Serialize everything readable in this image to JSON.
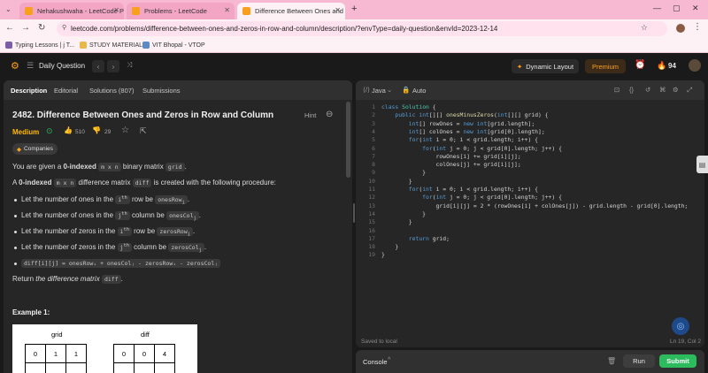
{
  "browser": {
    "tabs": [
      {
        "title": "Nehakushwaha - LeetCode Pro"
      },
      {
        "title": "Problems - LeetCode"
      },
      {
        "title": "Difference Between Ones and"
      }
    ],
    "url": "leetcode.com/problems/difference-between-ones-and-zeros-in-row-and-column/description/?envType=daily-question&envId=2023-12-14",
    "bookmarks": [
      "Typing Lessons | j T...",
      "STUDY MATERIAL",
      "VIT Bhopal - VTOP"
    ]
  },
  "header": {
    "title": "Daily Question",
    "dynamic_layout": "Dynamic Layout",
    "premium": "Premium",
    "streak": "94"
  },
  "left_tabs": [
    "Description",
    "Editorial",
    "Solutions (807)",
    "Submissions"
  ],
  "problem": {
    "title": "2482. Difference Between Ones and Zeros in Row and Column",
    "hint": "Hint",
    "difficulty": "Medium",
    "likes": "510",
    "dislikes": "29",
    "companies": "Companies",
    "intro_pre": "You are given a ",
    "intro_bold": "0-indexed",
    "intro_mid": "m x n",
    "intro_post": " binary matrix ",
    "intro_code": "grid",
    "intro_end": ".",
    "diff_pre": "A ",
    "diff_bold": "0-indexed",
    "diff_mid": "m x n",
    "diff_post": " difference matrix ",
    "diff_code": "diff",
    "diff_end": " is created with the following procedure:",
    "bullets": [
      {
        "pre": "Let the number of ones in the ",
        "sup": "i",
        "supx": "th",
        "mid": " row be ",
        "code": "onesRow",
        "sub": "i",
        "end": "."
      },
      {
        "pre": "Let the number of ones in the ",
        "sup": "j",
        "supx": "th",
        "mid": " column be ",
        "code": "onesCol",
        "sub": "j",
        "end": "."
      },
      {
        "pre": "Let the number of zeros in the ",
        "sup": "i",
        "supx": "th",
        "mid": " row be ",
        "code": "zerosRow",
        "sub": "i",
        "end": "."
      },
      {
        "pre": "Let the number of zeros in the ",
        "sup": "j",
        "supx": "th",
        "mid": " column be ",
        "code": "zerosCol",
        "sub": "j",
        "end": "."
      }
    ],
    "formula": "diff[i][j] = onesRowᵢ + onesColⱼ - zerosRowᵢ - zerosColⱼ",
    "return_pre": "Return ",
    "return_em": "the difference matrix",
    "return_code": "diff",
    "return_end": ".",
    "example_title": "Example 1:",
    "grid_label": "grid",
    "diff_label": "diff",
    "grid_row0": [
      "0",
      "1",
      "1"
    ],
    "diff_row0": [
      "0",
      "0",
      "4"
    ]
  },
  "editor": {
    "language": "Java",
    "mode": "Auto",
    "code": [
      "class Solution {",
      "    public int[][] onesMinusZeros(int[][] grid) {",
      "        int[] rowOnes = new int[grid.length];",
      "        int[] colOnes = new int[grid[0].length];",
      "        for(int i = 0; i < grid.length; i++) {",
      "            for(int j = 0; j < grid[0].length; j++) {",
      "                rowOnes[i] += grid[i][j];",
      "                colOnes[j] += grid[i][j];",
      "            }",
      "        }",
      "        for(int i = 0; i < grid.length; i++) {",
      "            for(int j = 0; j < grid[0].length; j++) {",
      "                grid[i][j] = 2 * (rowOnes[i] + colOnes[j]) - grid.length - grid[0].length;",
      "            }",
      "        }",
      "",
      "        return grid;",
      "    }",
      "}"
    ],
    "line_numbers": [
      "1",
      "2",
      "3",
      "4",
      "5",
      "6",
      "7",
      "8",
      "9",
      "10",
      "11",
      "12",
      "13",
      "14",
      "15",
      "16",
      "17",
      "18",
      "19"
    ],
    "saved": "Saved to local",
    "cursor": "Ln 19, Col 2"
  },
  "console": {
    "label": "Console",
    "run": "Run",
    "submit": "Submit"
  },
  "colors": {
    "medium": "#ffb800",
    "submit": "#2cbb5d",
    "premium": "#ffa116",
    "keyword": "#569cd6",
    "type": "#4ec9b0"
  }
}
